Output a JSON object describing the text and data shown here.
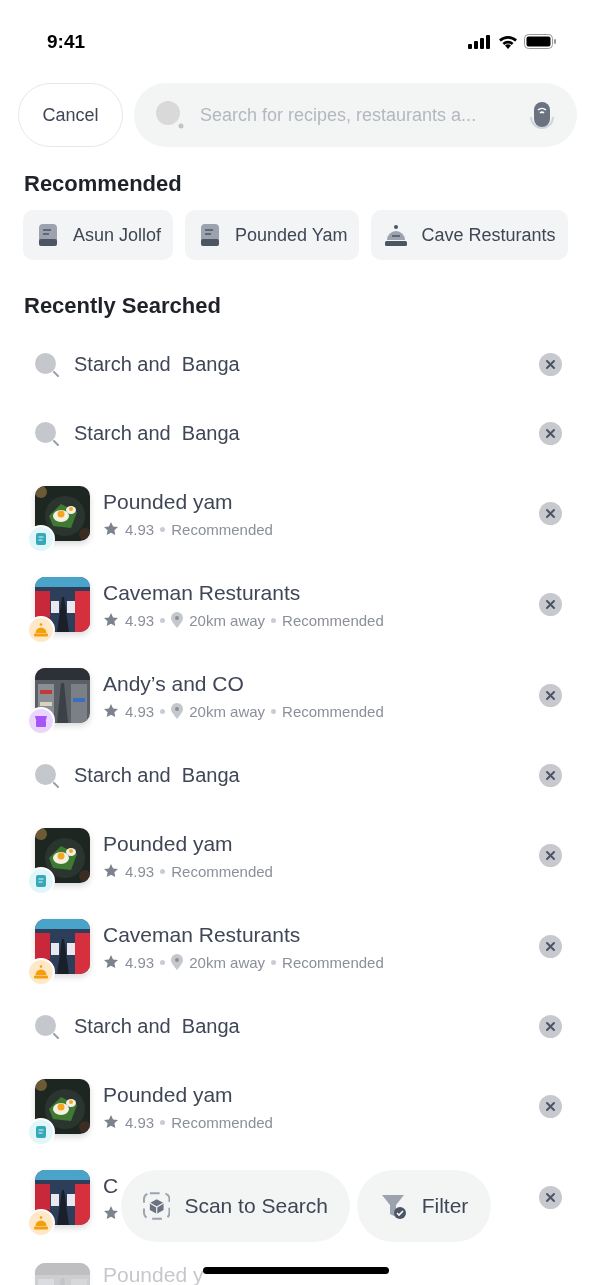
{
  "status_bar": {
    "time": "9:41"
  },
  "header": {
    "cancel": "Cancel",
    "search": {
      "placeholder": "Search for recipes, restaurants a..."
    }
  },
  "recommended": {
    "title": "Recommended",
    "chips": [
      {
        "label": "Asun Jollof",
        "kind": "book"
      },
      {
        "label": "Pounded Yam",
        "kind": "book"
      },
      {
        "label": "Cave Resturants",
        "kind": "bell"
      }
    ]
  },
  "recent": {
    "title": "Recently Searched",
    "rows": [
      {
        "kind": "search",
        "text": "Starch and  Banga"
      },
      {
        "kind": "search",
        "text": "Starch and  Banga"
      },
      {
        "kind": "place",
        "badge": {
          "kind": "recipe"
        },
        "title": "Pounded yam",
        "rating": "4.93",
        "tag": "Recommended"
      },
      {
        "kind": "place",
        "badge": {
          "kind": "restaurant"
        },
        "title": "Caveman Resturants",
        "rating": "4.93",
        "distance": "20km away",
        "tag": "Recommended"
      },
      {
        "kind": "place",
        "badge": {
          "kind": "store"
        },
        "title": "Andy’s and CO",
        "rating": "4.93",
        "distance": "20km away",
        "tag": "Recommended"
      },
      {
        "kind": "search",
        "text": "Starch and  Banga"
      },
      {
        "kind": "place",
        "badge": {
          "kind": "recipe"
        },
        "title": "Pounded yam",
        "rating": "4.93",
        "tag": "Recommended"
      },
      {
        "kind": "place",
        "badge": {
          "kind": "restaurant"
        },
        "title": "Caveman Resturants",
        "rating": "4.93",
        "distance": "20km away",
        "tag": "Recommended"
      },
      {
        "kind": "search",
        "text": "Starch and  Banga"
      },
      {
        "kind": "place",
        "badge": {
          "kind": "recipe"
        },
        "title": "Pounded yam",
        "rating": "4.93",
        "tag": "Recommended"
      },
      {
        "kind": "place",
        "badge": {
          "kind": "restaurant"
        },
        "title": "C"
      },
      {
        "kind": "place",
        "faded": true,
        "title": "Pounded y"
      }
    ]
  },
  "actions": [
    {
      "label": "Scan to Search",
      "kind": "scan"
    },
    {
      "label": "Filter",
      "kind": "filter"
    }
  ]
}
